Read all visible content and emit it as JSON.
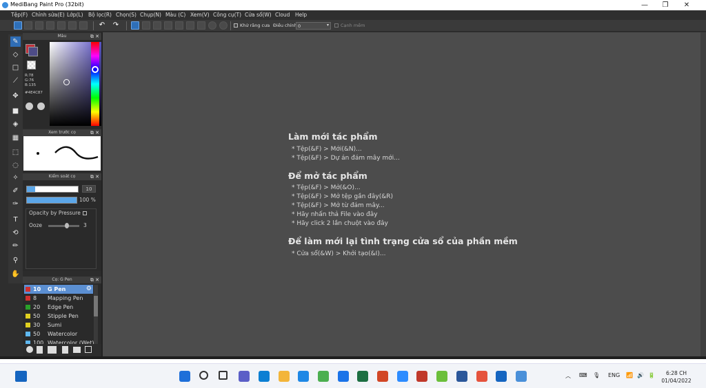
{
  "window": {
    "title": "MediBang Paint Pro (32bit)",
    "controls": {
      "minimize": "—",
      "maximize": "❐",
      "close": "✕"
    }
  },
  "menubar": [
    "Tệp(F)",
    "Chỉnh sửa(E)",
    "Lớp(L)",
    "Bộ lọc(R)",
    "Chọn(S)",
    "Chụp(N)",
    "Màu (C)",
    "Xem(V)",
    "Công cụ(T)",
    "Cửa sổ(W)",
    "Cloud",
    "Help"
  ],
  "toolbar": {
    "antialias_label": "Khử răng cưa",
    "adjust_label": "Điều chỉnh",
    "adjust_value": "0",
    "smooth_label": "Cạnh mềm"
  },
  "panels": {
    "color": {
      "title": "Màu",
      "r": "R:78",
      "g": "G:76",
      "b": "B:135",
      "hex": "#4E4C87",
      "current_color": "#4E4C87",
      "second_color": "#c0303a"
    },
    "brush_preview": {
      "title": "Xem trước cọ"
    },
    "brush_control": {
      "title": "Kiểm soát cọ",
      "size_value": "10",
      "opacity_value": "100 %",
      "opacity_pressure_label": "Opacity by Pressure",
      "ooze_label": "Ooze",
      "ooze_value": "3"
    },
    "brush_list": {
      "title": "Cọ: G Pen",
      "items": [
        {
          "size": "10",
          "name": "G Pen",
          "color": "#d03030",
          "selected": true
        },
        {
          "size": "8",
          "name": "Mapping Pen",
          "color": "#d03030",
          "selected": false
        },
        {
          "size": "20",
          "name": "Edge Pen",
          "color": "#2aa02a",
          "selected": false
        },
        {
          "size": "50",
          "name": "Stipple Pen",
          "color": "#e0d020",
          "selected": false
        },
        {
          "size": "30",
          "name": "Sumi",
          "color": "#e0d020",
          "selected": false
        },
        {
          "size": "50",
          "name": "Watercolor",
          "color": "#5fb8f0",
          "selected": false
        },
        {
          "size": "100",
          "name": "Watercolor (Wet)",
          "color": "#5fb8f0",
          "selected": false
        }
      ]
    }
  },
  "canvas": {
    "sections": [
      {
        "heading": "Làm mới tác phẩm",
        "lines": [
          "* Tệp(&F) > Mới(&N)...",
          "* Tệp(&F) > Dự án đám mây mới..."
        ]
      },
      {
        "heading": "Để mở tác phẩm",
        "lines": [
          "* Tệp(&F) > Mở(&O)...",
          "* Tệp(&F) > Mở tệp gần đây(&R)",
          "* Tệp(&F) > Mở từ đám mây...",
          "* Hãy nhấn thả File vào đây",
          "* Hãy click 2 lần chuột vào đây"
        ]
      },
      {
        "heading": "Để làm mới lại tình trạng cửa sổ của phần mềm",
        "lines": [
          "* Cửa sổ(&W) > Khởi tạo(&I)..."
        ]
      }
    ]
  },
  "taskbar": {
    "language": "ENG",
    "time": "6:28 CH",
    "date": "01/04/2022",
    "pinned": [
      "start-icon",
      "search-icon",
      "task-view-icon",
      "chat-icon",
      "edge-icon",
      "file-explorer-icon",
      "app-icon",
      "chrome-icon",
      "zalo-icon",
      "excel-icon",
      "powerpoint-icon",
      "zoom-icon",
      "app-icon",
      "app-icon",
      "word-icon",
      "app-icon",
      "app-icon",
      "medibang-icon"
    ]
  }
}
